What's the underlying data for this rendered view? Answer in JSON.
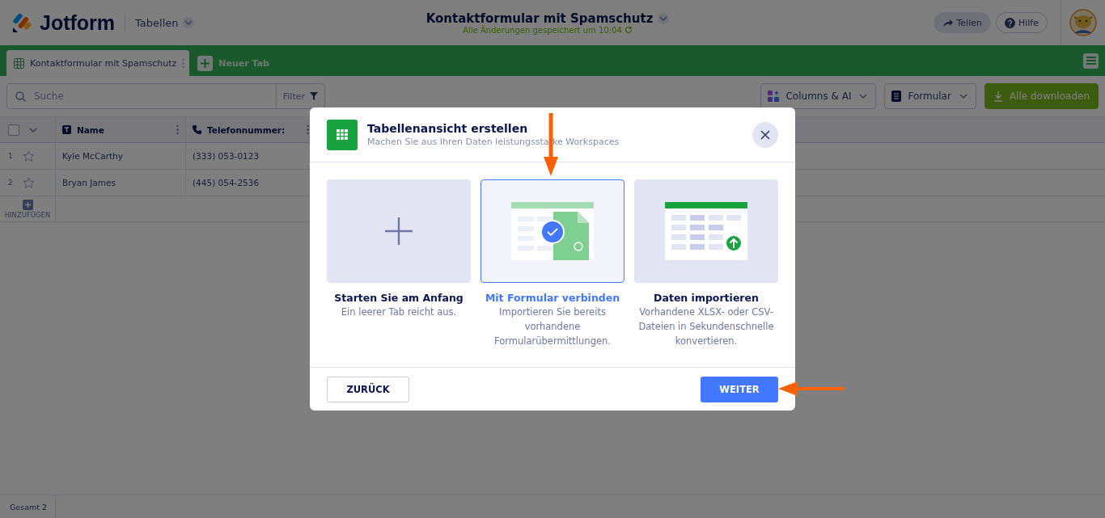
{
  "header": {
    "logo": "Jotform",
    "product": "Tabellen",
    "title": "Kontaktformular mit Spamschutz",
    "status": "Alle Änderungen gespeichert um 10:04",
    "buttons": [
      {
        "kind": "share",
        "label": "Teilen"
      },
      {
        "kind": "help",
        "label": "Hilfe"
      }
    ]
  },
  "tabs": [
    {
      "label": "Kontaktformular mit Spamschutz",
      "selected": true
    }
  ],
  "new_tab_button": "Neuer Tab",
  "toolbar": {
    "search": {
      "placeholder": "Suche"
    },
    "filter": "Filter",
    "buttons": [
      {
        "kind": "columns",
        "label": "Columns & AI"
      },
      {
        "kind": "form",
        "label": "Formular"
      },
      {
        "kind": "download",
        "label": "Alle downloaden"
      }
    ]
  },
  "table": {
    "select_all_checked": false,
    "columns": [
      {
        "kind": "text",
        "name": "Name"
      },
      {
        "kind": "phone",
        "name": "Telefonnummer:"
      }
    ],
    "rows": [
      {
        "number": "1",
        "starred": false,
        "cells": [
          "Kyle McCarthy",
          "(333) 053-0123"
        ]
      },
      {
        "number": "2",
        "starred": false,
        "cells": [
          "Bryan James",
          "(445) 054-2536"
        ]
      }
    ],
    "add_row": "HINZUFÜGEN"
  },
  "status_bar": "Gesamt 2",
  "modal": {
    "title": "Tabellenansicht erstellen",
    "subtitle": "Machen Sie aus Ihren Daten leistungsstarke Workspaces",
    "options": [
      {
        "kind": "blank",
        "title": "Starten Sie am Anfang",
        "description": "Ein leerer Tab reicht aus.",
        "selected": false
      },
      {
        "kind": "form",
        "title": "Mit Formular verbinden",
        "description": "Importieren Sie bereits vorhandene Formularübermittlungen.",
        "selected": true
      },
      {
        "kind": "import",
        "title": "Daten importieren",
        "description": "Vorhandene XLSX- oder CSV-Dateien in Sekundenschnelle konvertieren.",
        "selected": false
      }
    ],
    "back_button": "ZURÜCK",
    "next_button": "WEITER"
  }
}
